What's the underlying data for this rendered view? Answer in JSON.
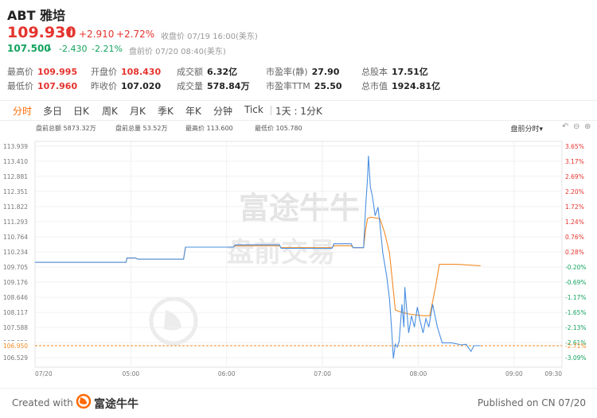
{
  "stock": {
    "symbol_name": "ABT 雅培",
    "price": "109.930",
    "price_arrow": "⬆",
    "change": "+2.910",
    "change_pct": "+2.72%",
    "status": "收盘价 07/19 16:00(美东)",
    "pre_price": "107.500",
    "pre_arrow": "↓",
    "pre_change": "-2.430",
    "pre_change_pct": "-2.21%",
    "pre_status": "盘前价 07/20 08:40(美东)"
  },
  "stats": [
    {
      "label": "最高价",
      "value": "109.995",
      "tone": "red"
    },
    {
      "label": "开盘价",
      "value": "108.430",
      "tone": "red"
    },
    {
      "label": "成交额",
      "value": "6.32亿",
      "tone": "normal"
    },
    {
      "label": "市盈率(静)",
      "value": "27.90",
      "tone": "normal"
    },
    {
      "label": "总股本",
      "value": "17.51亿",
      "tone": "normal"
    },
    {
      "label": "最低价",
      "value": "107.960",
      "tone": "red"
    },
    {
      "label": "昨收价",
      "value": "107.020",
      "tone": "normal"
    },
    {
      "label": "成交量",
      "value": "578.84万",
      "tone": "normal"
    },
    {
      "label": "市盈率TTM",
      "value": "25.50",
      "tone": "normal"
    },
    {
      "label": "总市值",
      "value": "1924.81亿",
      "tone": "normal"
    }
  ],
  "tabs": [
    "分时",
    "多日",
    "日K",
    "周K",
    "月K",
    "季K",
    "年K",
    "分钟",
    "Tick",
    "1天 : 1分K"
  ],
  "active_tab": "分时",
  "chart_header": {
    "turnover": "盘前总额 5873.32万",
    "volume": "盘前总量 53.52万",
    "high": "最高价 113.600",
    "low": "最低价 105.780",
    "mode": "盘前分时",
    "mode_arrow": "▾"
  },
  "chart_data": {
    "type": "line",
    "y_ticks_left": [
      "113.939",
      "113.410",
      "112.881",
      "112.351",
      "111.822",
      "111.293",
      "110.764",
      "110.234",
      "109.705",
      "109.176",
      "108.646",
      "108.117",
      "107.588",
      "107.059",
      "106.529"
    ],
    "y_ticks_right": [
      "3.65%",
      "3.17%",
      "2.69%",
      "2.20%",
      "1.72%",
      "1.24%",
      "0.76%",
      "0.28%",
      "-0.20%",
      "-0.69%",
      "-1.17%",
      "-1.65%",
      "-2.13%",
      "-2.61%",
      "-3.09%"
    ],
    "x_ticks": [
      "07/20",
      "05:00",
      "06:00",
      "07:00",
      "08:00",
      "09:00",
      "09:30"
    ],
    "ylim": [
      106.2,
      114.1
    ],
    "ref_price_label": "106.950",
    "ref_pct_label": "-2.71%",
    "ref_price": 106.95,
    "time_range_hours": [
      4.0,
      9.5
    ],
    "series": [
      {
        "color": "#4a90e2",
        "points": [
          [
            4.0,
            109.87
          ],
          [
            4.95,
            109.87
          ],
          [
            4.96,
            110.02
          ],
          [
            5.05,
            110.02
          ],
          [
            5.07,
            109.98
          ],
          [
            5.55,
            109.98
          ],
          [
            5.57,
            110.4
          ],
          [
            6.07,
            110.4
          ],
          [
            6.09,
            110.48
          ],
          [
            6.55,
            110.48
          ],
          [
            6.57,
            110.36
          ],
          [
            7.1,
            110.36
          ],
          [
            7.12,
            110.52
          ],
          [
            7.3,
            110.52
          ],
          [
            7.32,
            110.38
          ],
          [
            7.43,
            110.38
          ],
          [
            7.45,
            111.8
          ],
          [
            7.47,
            112.8
          ],
          [
            7.48,
            113.6
          ],
          [
            7.5,
            112.5
          ],
          [
            7.52,
            112.2
          ],
          [
            7.55,
            111.5
          ],
          [
            7.58,
            111.8
          ],
          [
            7.6,
            111.2
          ],
          [
            7.63,
            110.2
          ],
          [
            7.67,
            109.4
          ],
          [
            7.7,
            108.6
          ],
          [
            7.72,
            107.6
          ],
          [
            7.74,
            106.5
          ],
          [
            7.76,
            107.0
          ],
          [
            7.78,
            106.9
          ],
          [
            7.8,
            107.1
          ],
          [
            7.83,
            108.4
          ],
          [
            7.85,
            107.6
          ],
          [
            7.86,
            109.0
          ],
          [
            7.88,
            108.2
          ],
          [
            7.9,
            107.4
          ],
          [
            7.93,
            108.0
          ],
          [
            7.96,
            107.6
          ],
          [
            7.99,
            108.3
          ],
          [
            8.02,
            107.8
          ],
          [
            8.05,
            107.4
          ],
          [
            8.08,
            107.9
          ],
          [
            8.11,
            107.6
          ],
          [
            8.15,
            108.4
          ],
          [
            8.2,
            107.6
          ],
          [
            8.25,
            107.05
          ],
          [
            8.35,
            107.05
          ],
          [
            8.45,
            106.98
          ],
          [
            8.5,
            107.0
          ],
          [
            8.55,
            106.75
          ],
          [
            8.58,
            106.95
          ],
          [
            8.65,
            106.95
          ]
        ]
      },
      {
        "color": "#f08a24",
        "points": [
          [
            4.0,
            109.87
          ],
          [
            4.95,
            109.87
          ],
          [
            4.96,
            110.02
          ],
          [
            5.05,
            110.02
          ],
          [
            5.07,
            109.98
          ],
          [
            5.55,
            109.98
          ],
          [
            5.57,
            110.4
          ],
          [
            6.07,
            110.4
          ],
          [
            6.09,
            110.45
          ],
          [
            6.55,
            110.45
          ],
          [
            6.57,
            110.38
          ],
          [
            7.1,
            110.38
          ],
          [
            7.12,
            110.45
          ],
          [
            7.3,
            110.45
          ],
          [
            7.32,
            110.38
          ],
          [
            7.43,
            110.38
          ],
          [
            7.45,
            111.0
          ],
          [
            7.47,
            111.4
          ],
          [
            7.5,
            111.45
          ],
          [
            7.6,
            111.4
          ],
          [
            7.65,
            110.9
          ],
          [
            7.7,
            110.2
          ],
          [
            7.73,
            109.2
          ],
          [
            7.76,
            108.2
          ],
          [
            7.8,
            108.15
          ],
          [
            7.85,
            108.1
          ],
          [
            7.92,
            108.05
          ],
          [
            8.05,
            108.0
          ],
          [
            8.12,
            108.0
          ],
          [
            8.15,
            108.5
          ],
          [
            8.18,
            109.0
          ],
          [
            8.22,
            109.8
          ],
          [
            8.4,
            109.8
          ],
          [
            8.65,
            109.75
          ]
        ]
      }
    ]
  },
  "watermark": {
    "brand_line1": "富途牛牛",
    "brand_line2": "盘前交易"
  },
  "footer": {
    "created_with": "Created with",
    "brand": "富途牛牛",
    "published": "Published on CN 07/20"
  },
  "colors": {
    "up": "#e5332d",
    "down": "#14a35e",
    "accent": "#ff6a00",
    "line_price": "#4a90e2",
    "line_avg": "#f08a24"
  }
}
